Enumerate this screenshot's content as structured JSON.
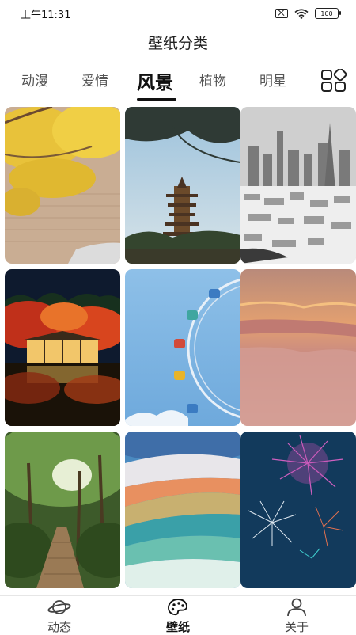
{
  "status_bar": {
    "time": "上午11:31",
    "battery": "100",
    "icons": [
      "sim-off-icon",
      "wifi-icon",
      "battery-icon"
    ]
  },
  "header": {
    "title": "壁纸分类"
  },
  "tabs": [
    {
      "label": "动漫",
      "active": false
    },
    {
      "label": "爱情",
      "active": false
    },
    {
      "label": "风景",
      "active": true
    },
    {
      "label": "植物",
      "active": false
    },
    {
      "label": "明星",
      "active": false
    }
  ],
  "categories_button_icon": "category-grid-icon",
  "wallpapers": [
    {
      "subject": "autumn-ginkgo-tree"
    },
    {
      "subject": "pagoda-tower"
    },
    {
      "subject": "city-skyline-bw"
    },
    {
      "subject": "pavilion-red-maples-night"
    },
    {
      "subject": "ferris-wheel-sky"
    },
    {
      "subject": "sunset-cloud-sea"
    },
    {
      "subject": "forest-boardwalk"
    },
    {
      "subject": "colorful-waves"
    },
    {
      "subject": "fireworks-night"
    }
  ],
  "bottom_nav": {
    "items": [
      {
        "label": "动态",
        "icon": "planet-icon",
        "active": false
      },
      {
        "label": "壁纸",
        "icon": "palette-icon",
        "active": true
      },
      {
        "label": "关于",
        "icon": "person-icon",
        "active": false
      }
    ]
  },
  "colors": {
    "active_text": "#111111",
    "inactive_text": "#555555",
    "background": "#ffffff"
  }
}
